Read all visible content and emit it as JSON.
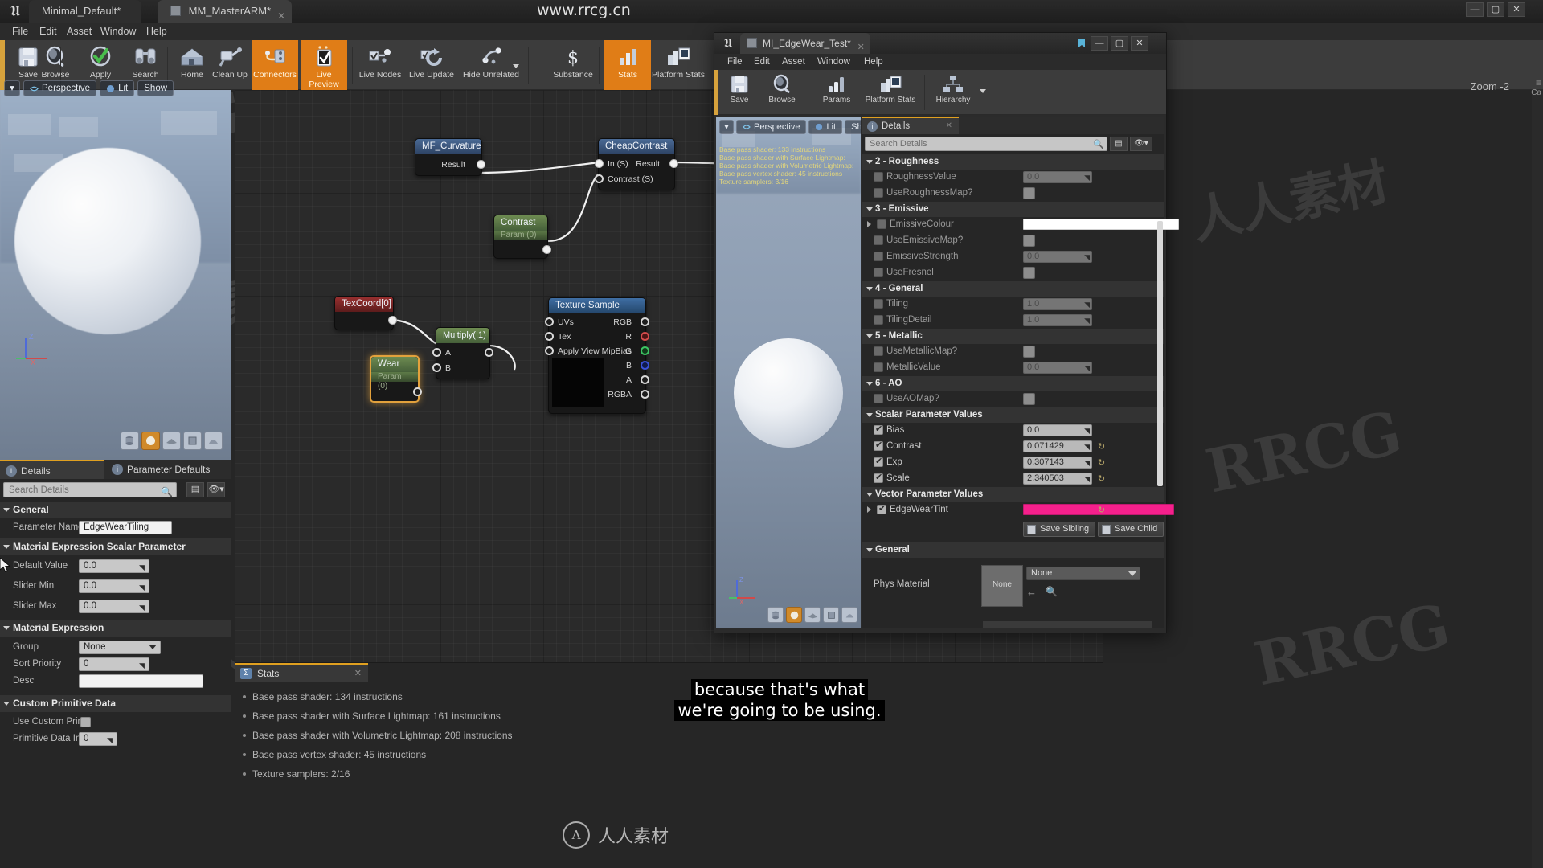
{
  "app": {
    "title_tabs": [
      {
        "label": "Minimal_Default*",
        "active": false
      },
      {
        "label": "MM_MasterARM*",
        "active": true
      }
    ],
    "menu": [
      "File",
      "Edit",
      "Asset",
      "Window",
      "Help"
    ],
    "window_controls": [
      "—",
      "▢",
      "✕"
    ],
    "watermark_top": "www.rrcg.cn"
  },
  "toolbar": {
    "buttons": [
      {
        "label": "Save",
        "icon": "save-icon",
        "highlight": false
      },
      {
        "label": "Browse",
        "icon": "browse-icon",
        "highlight": false
      },
      {
        "label": "Apply",
        "icon": "apply-check-icon",
        "highlight": false
      },
      {
        "label": "Search",
        "icon": "search-binoculars-icon",
        "highlight": false
      },
      {
        "label": "Home",
        "icon": "home-icon",
        "highlight": false
      },
      {
        "label": "Clean Up",
        "icon": "clean-up-icon",
        "highlight": false
      },
      {
        "label": "Connectors",
        "icon": "connectors-icon",
        "highlight": true
      },
      {
        "label": "Live Preview",
        "icon": "live-preview-icon",
        "highlight": true
      },
      {
        "label": "Live Nodes",
        "icon": "live-nodes-icon",
        "highlight": false
      },
      {
        "label": "Live Update",
        "icon": "live-update-icon",
        "highlight": false
      },
      {
        "label": "Hide Unrelated",
        "icon": "hide-unrelated-icon",
        "highlight": false
      },
      {
        "label": "Substance",
        "icon": "substance-dollar-icon",
        "highlight": false
      },
      {
        "label": "Stats",
        "icon": "stats-icon",
        "highlight": true
      },
      {
        "label": "Platform Stats",
        "icon": "platform-stats-icon",
        "highlight": false
      }
    ]
  },
  "viewport": {
    "view_mode_arrow": "▾",
    "perspective": "Perspective",
    "lit": "Lit",
    "show": "Show",
    "axis_z": "Z",
    "axis_x": "X",
    "zoom_label": "Zoom  -2"
  },
  "left_details": {
    "tabs": [
      {
        "label": "Details",
        "active": true
      },
      {
        "label": "Parameter Defaults",
        "active": false
      }
    ],
    "search_placeholder": "Search Details",
    "sections": [
      {
        "title": "General",
        "rows": [
          {
            "key": "Parameter Name",
            "value": "EdgeWearTiling",
            "type": "text"
          }
        ]
      },
      {
        "title": "Material Expression Scalar Parameter",
        "rows": [
          {
            "key": "Default Value",
            "value": "0.0",
            "type": "num"
          },
          {
            "key": "Slider Min",
            "value": "0.0",
            "type": "num"
          },
          {
            "key": "Slider Max",
            "value": "0.0",
            "type": "num"
          }
        ]
      },
      {
        "title": "Material Expression",
        "rows": [
          {
            "key": "Group",
            "value": "None",
            "type": "combo"
          },
          {
            "key": "Sort Priority",
            "value": "0",
            "type": "num"
          },
          {
            "key": "Desc",
            "value": "",
            "type": "text"
          }
        ]
      },
      {
        "title": "Custom Primitive Data",
        "rows": [
          {
            "key": "Use Custom Primitiv",
            "value": "",
            "type": "check"
          },
          {
            "key": "Primitive Data Index",
            "value": "0",
            "type": "num"
          }
        ]
      }
    ]
  },
  "graph": {
    "nodes": [
      {
        "id": "mf_curvature",
        "title": "MF_Curvature",
        "header": "blue",
        "outputs": [
          "Result"
        ],
        "inputs": []
      },
      {
        "id": "cheap_contrast",
        "title": "CheapContrast",
        "header": "blue",
        "inputs": [
          "In (S)",
          "Contrast (S)"
        ],
        "outputs": [
          "Result"
        ]
      },
      {
        "id": "contrast_param",
        "title": "Contrast",
        "subtitle": "Param (0)",
        "header": "green"
      },
      {
        "id": "texcoord",
        "title": "TexCoord[0]",
        "header": "red"
      },
      {
        "id": "multiply",
        "title": "Multiply(,1)",
        "header": "green",
        "inputs": [
          "A",
          "B"
        ]
      },
      {
        "id": "wear_param",
        "title": "Wear",
        "subtitle": "Param (0)",
        "header": "green",
        "selected": true
      },
      {
        "id": "texture_sample",
        "title": "Texture Sample",
        "header": "texsample",
        "inputs": [
          "UVs",
          "Tex",
          "Apply View MipBias"
        ],
        "outputs": [
          "RGB",
          "R",
          "G",
          "B",
          "A",
          "RGBA"
        ]
      }
    ]
  },
  "stats": {
    "panel_title": "Stats",
    "lines": [
      "Base pass shader: 134 instructions",
      "Base pass shader with Surface Lightmap: 161 instructions",
      "Base pass shader with Volumetric Lightmap: 208 instructions",
      "Base pass vertex shader: 45 instructions",
      "Texture samplers: 2/16"
    ]
  },
  "subtitle": {
    "line1": "because that's what",
    "line2": "we're going to be using."
  },
  "mi_window": {
    "tab_label": "MI_EdgeWear_Test*",
    "menu": [
      "File",
      "Edit",
      "Asset",
      "Window",
      "Help"
    ],
    "window_controls": [
      "—",
      "▢",
      "✕"
    ],
    "toolbar": [
      {
        "label": "Save",
        "icon": "save-icon"
      },
      {
        "label": "Browse",
        "icon": "browse-icon"
      },
      {
        "label": "Params",
        "icon": "params-icon"
      },
      {
        "label": "Platform Stats",
        "icon": "platform-stats-icon"
      },
      {
        "label": "Hierarchy",
        "icon": "hierarchy-icon"
      }
    ],
    "viewport": {
      "perspective": "Perspective",
      "lit": "Lit",
      "show": "Show",
      "overlay_stats": [
        "Base pass shader: 133 instructions",
        "Base pass shader with Surface Lightmap:",
        "Base pass shader with Volumetric Lightmap:",
        "Base pass vertex shader: 45 instructions",
        "Texture samplers: 3/16"
      ],
      "axis_z": "Z",
      "axis_x": "X"
    },
    "details": {
      "tab_label": "Details",
      "search_placeholder": "Search Details",
      "groups": [
        {
          "title": "2 - Roughness",
          "rows": [
            {
              "key": "RoughnessValue",
              "type": "num",
              "value": "0.0",
              "checked": false,
              "dim": true
            },
            {
              "key": "UseRoughnessMap?",
              "type": "bool",
              "value": "",
              "checked": false,
              "dim": true
            }
          ]
        },
        {
          "title": "3 - Emissive",
          "rows": [
            {
              "key": "EmissiveColour",
              "type": "color",
              "value": "#ffffff",
              "checked": false,
              "dim": true,
              "expandable": true
            },
            {
              "key": "UseEmissiveMap?",
              "type": "bool",
              "value": "",
              "checked": false,
              "dim": true
            },
            {
              "key": "EmissiveStrength",
              "type": "num",
              "value": "0.0",
              "checked": false,
              "dim": true
            },
            {
              "key": "UseFresnel",
              "type": "bool",
              "value": "",
              "checked": false,
              "dim": true
            }
          ]
        },
        {
          "title": "4 - General",
          "rows": [
            {
              "key": "Tiling",
              "type": "num",
              "value": "1.0",
              "checked": false,
              "dim": true
            },
            {
              "key": "TilingDetail",
              "type": "num",
              "value": "1.0",
              "checked": false,
              "dim": true
            }
          ]
        },
        {
          "title": "5 - Metallic",
          "rows": [
            {
              "key": "UseMetallicMap?",
              "type": "bool",
              "value": "",
              "checked": false,
              "dim": true
            },
            {
              "key": "MetallicValue",
              "type": "num",
              "value": "0.0",
              "checked": false,
              "dim": true
            }
          ]
        },
        {
          "title": "6 - AO",
          "rows": [
            {
              "key": "UseAOMap?",
              "type": "bool",
              "value": "",
              "checked": false,
              "dim": true
            }
          ]
        },
        {
          "title": "Scalar Parameter Values",
          "rows": [
            {
              "key": "Bias",
              "type": "num",
              "value": "0.0",
              "checked": true,
              "dim": false
            },
            {
              "key": "Contrast",
              "type": "num",
              "value": "0.071429",
              "checked": true,
              "dim": false,
              "reset": true
            },
            {
              "key": "Exp",
              "type": "num",
              "value": "0.307143",
              "checked": true,
              "dim": false,
              "reset": true
            },
            {
              "key": "Scale",
              "type": "num",
              "value": "2.340503",
              "checked": true,
              "dim": false,
              "reset": true
            }
          ]
        },
        {
          "title": "Vector Parameter Values",
          "rows": [
            {
              "key": "EdgeWearTint",
              "type": "color",
              "value": "#f5208c",
              "checked": true,
              "dim": false,
              "expandable": true,
              "reset": true
            }
          ]
        }
      ],
      "save_sibling": "Save Sibling",
      "save_child": "Save Child",
      "general_title": "General",
      "phys_material_key": "Phys Material",
      "phys_material_value": "None",
      "phys_material_thumb": "None"
    }
  },
  "watermarks": {
    "bottom_text": "人人素材",
    "bottom_mark": "Λ",
    "tiles": [
      "RRCG",
      "人人素材",
      "RRCG",
      "RRCG",
      "人人素材",
      "RRCG"
    ]
  }
}
